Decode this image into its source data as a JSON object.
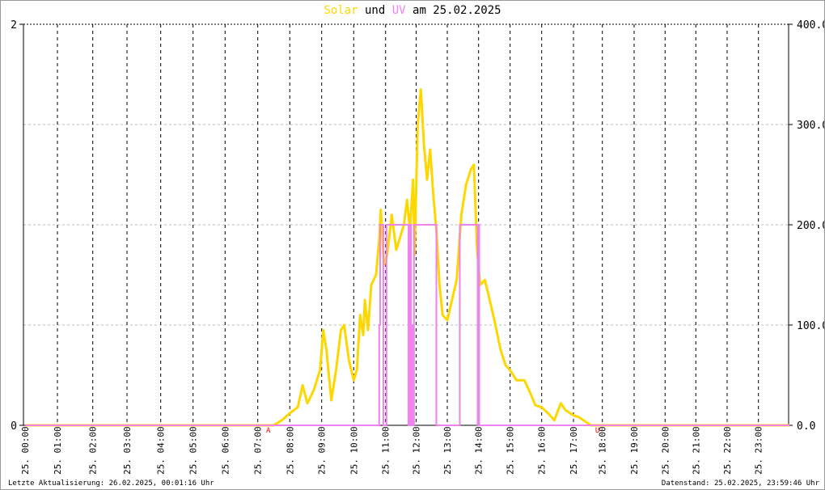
{
  "title": {
    "solar": "Solar",
    "und": "und",
    "uv": "UV",
    "rest": "am 25.02.2025"
  },
  "footer": {
    "left": "Letzte Aktualisierung: 26.02.2025, 00:01:16 Uhr",
    "right": "Datenstand: 25.02.2025, 23:59:46 Uhr"
  },
  "markers": {
    "start": "A",
    "end": "U"
  },
  "colors": {
    "solar": "#FFD700",
    "uv": "#EE82EE",
    "marker": "#FF0000"
  },
  "chart_data": {
    "type": "line",
    "title": "Solar und UV am 25.02.2025",
    "x_tick_labels": [
      "25. 00:00",
      "25. 01:00",
      "25. 02:00",
      "25. 03:00",
      "25. 04:00",
      "25. 05:00",
      "25. 06:00",
      "25. 07:00",
      "25. 08:00",
      "25. 09:00",
      "25. 10:00",
      "25. 11:00",
      "25. 12:00",
      "25. 13:00",
      "25. 14:00",
      "25. 15:00",
      "25. 16:00",
      "25. 17:00",
      "25. 18:00",
      "25. 19:00",
      "25. 20:00",
      "25. 21:00",
      "25. 22:00",
      "25. 23:00"
    ],
    "y_left": {
      "label": "UV",
      "ticks": [
        "2",
        "0"
      ],
      "range": [
        0,
        2
      ]
    },
    "y_right": {
      "label": "Solar",
      "ticks": [
        "400.0",
        "300.0",
        "200.0",
        "100.0",
        "0.0"
      ],
      "range": [
        0,
        400
      ]
    },
    "marker_times": {
      "A": 7.33,
      "U": 17.83
    },
    "series": [
      {
        "name": "Solar",
        "axis": "right",
        "points": [
          [
            0,
            0
          ],
          [
            7.5,
            0
          ],
          [
            7.75,
            5
          ],
          [
            8,
            12
          ],
          [
            8.25,
            18
          ],
          [
            8.4,
            40
          ],
          [
            8.55,
            22
          ],
          [
            8.75,
            35
          ],
          [
            8.85,
            45
          ],
          [
            8.95,
            55
          ],
          [
            9.05,
            95
          ],
          [
            9.15,
            75
          ],
          [
            9.3,
            25
          ],
          [
            9.45,
            55
          ],
          [
            9.6,
            95
          ],
          [
            9.7,
            100
          ],
          [
            9.85,
            65
          ],
          [
            10,
            45
          ],
          [
            10.1,
            55
          ],
          [
            10.2,
            110
          ],
          [
            10.3,
            90
          ],
          [
            10.35,
            125
          ],
          [
            10.45,
            95
          ],
          [
            10.55,
            140
          ],
          [
            10.7,
            150
          ],
          [
            10.8,
            185
          ],
          [
            10.85,
            215
          ],
          [
            10.95,
            160
          ],
          [
            11.05,
            170
          ],
          [
            11.2,
            210
          ],
          [
            11.35,
            175
          ],
          [
            11.5,
            190
          ],
          [
            11.6,
            200
          ],
          [
            11.7,
            225
          ],
          [
            11.8,
            195
          ],
          [
            11.9,
            245
          ],
          [
            11.95,
            170
          ],
          [
            12.05,
            300
          ],
          [
            12.15,
            335
          ],
          [
            12.25,
            280
          ],
          [
            12.35,
            245
          ],
          [
            12.45,
            275
          ],
          [
            12.55,
            230
          ],
          [
            12.65,
            195
          ],
          [
            12.75,
            140
          ],
          [
            12.85,
            110
          ],
          [
            13,
            105
          ],
          [
            13.15,
            125
          ],
          [
            13.3,
            145
          ],
          [
            13.45,
            210
          ],
          [
            13.6,
            240
          ],
          [
            13.75,
            255
          ],
          [
            13.85,
            260
          ],
          [
            13.95,
            175
          ],
          [
            14.05,
            140
          ],
          [
            14.2,
            145
          ],
          [
            14.35,
            125
          ],
          [
            14.5,
            105
          ],
          [
            14.7,
            75
          ],
          [
            14.85,
            60
          ],
          [
            15,
            55
          ],
          [
            15.2,
            45
          ],
          [
            15.45,
            45
          ],
          [
            15.6,
            35
          ],
          [
            15.8,
            20
          ],
          [
            16,
            18
          ],
          [
            16.2,
            12
          ],
          [
            16.4,
            5
          ],
          [
            16.6,
            22
          ],
          [
            16.75,
            15
          ],
          [
            17,
            10
          ],
          [
            17.2,
            8
          ],
          [
            17.45,
            3
          ],
          [
            17.6,
            0
          ],
          [
            24,
            0
          ]
        ]
      },
      {
        "name": "UV",
        "axis": "left",
        "step": true,
        "points": [
          [
            0,
            0
          ],
          [
            10.8,
            0.5
          ],
          [
            10.83,
            1
          ],
          [
            10.93,
            0
          ],
          [
            11.03,
            1
          ],
          [
            11.75,
            0
          ],
          [
            11.78,
            0.5
          ],
          [
            11.8,
            1
          ],
          [
            11.83,
            0
          ],
          [
            11.86,
            0.5
          ],
          [
            11.9,
            0
          ],
          [
            11.93,
            1
          ],
          [
            12.65,
            0
          ],
          [
            13.4,
            1
          ],
          [
            13.97,
            0
          ],
          [
            13.99,
            1
          ],
          [
            14.02,
            0
          ],
          [
            24,
            0
          ]
        ]
      }
    ]
  }
}
